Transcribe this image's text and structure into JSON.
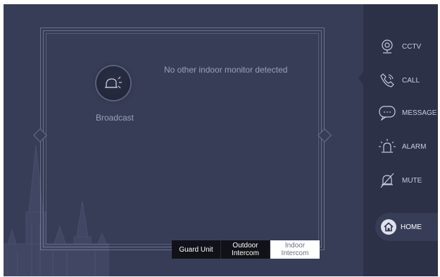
{
  "main": {
    "broadcast_label": "Broadcast",
    "status_message": "No other indoor monitor detected"
  },
  "tabs": [
    {
      "label": "Guard Unit",
      "selected": false
    },
    {
      "label": "Outdoor\nIntercom",
      "selected": false
    },
    {
      "label": "Indoor Intercom",
      "selected": true
    }
  ],
  "sidebar": {
    "items": [
      {
        "label": "CCTV",
        "icon": "cctv-camera-icon"
      },
      {
        "label": "CALL",
        "icon": "phone-icon"
      },
      {
        "label": "MESSAGE",
        "icon": "message-bubble-icon"
      },
      {
        "label": "ALARM",
        "icon": "alarm-siren-icon"
      },
      {
        "label": "MUTE",
        "icon": "bell-muted-icon"
      },
      {
        "label": "HOME",
        "icon": "home-icon"
      }
    ]
  },
  "colors": {
    "background": "#383d57",
    "sidebar": "#2c3148",
    "text_muted": "#9aa0ba",
    "tab_dark": "#111217",
    "tab_selected": "#ffffff"
  }
}
